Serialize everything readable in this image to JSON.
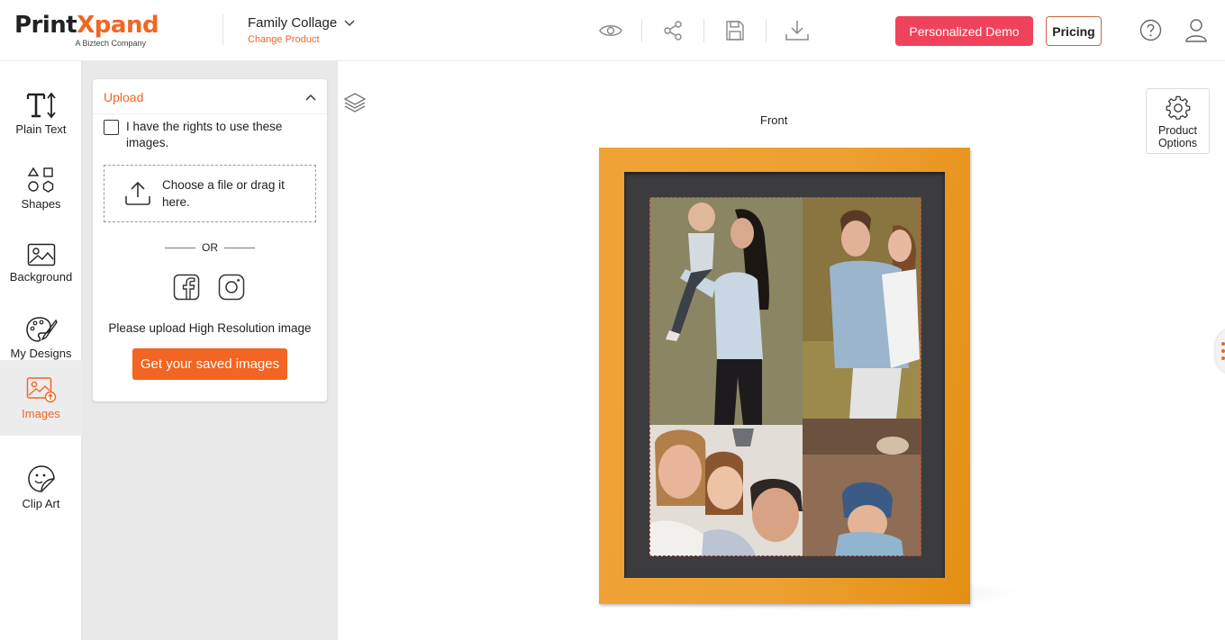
{
  "header": {
    "logo_main": "Print",
    "logo_x": "X",
    "logo_rest": "pand",
    "logo_sub": "A Biztech Company",
    "product_name": "Family Collage",
    "change_product": "Change Product",
    "tools": [
      "eye-icon",
      "share-icon",
      "save-icon",
      "download-icon"
    ],
    "demo_label": "Personalized Demo",
    "pricing_label": "Pricing"
  },
  "sidebar": {
    "items": [
      {
        "label": "Plain Text",
        "icon": "text-icon"
      },
      {
        "label": "Shapes",
        "icon": "shapes-icon"
      },
      {
        "label": "Background",
        "icon": "image-icon"
      },
      {
        "label": "My Designs",
        "icon": "palette-icon"
      },
      {
        "label": "Images",
        "icon": "images-icon",
        "active": true
      },
      {
        "label": "Clip Art",
        "icon": "sticker-icon"
      }
    ]
  },
  "upload": {
    "title": "Upload",
    "rights_text": "I have the rights to use these images.",
    "rights_checked": false,
    "drop_text": "Choose a file or drag it here.",
    "or_text": "OR",
    "hires_text": "Please upload High Resolution image",
    "saved_button": "Get your saved images"
  },
  "canvas": {
    "side_label": "Front",
    "product_options": "Product Options"
  },
  "colors": {
    "accent": "#f26522",
    "demo": "#f0435b",
    "frame": "#eea032"
  }
}
